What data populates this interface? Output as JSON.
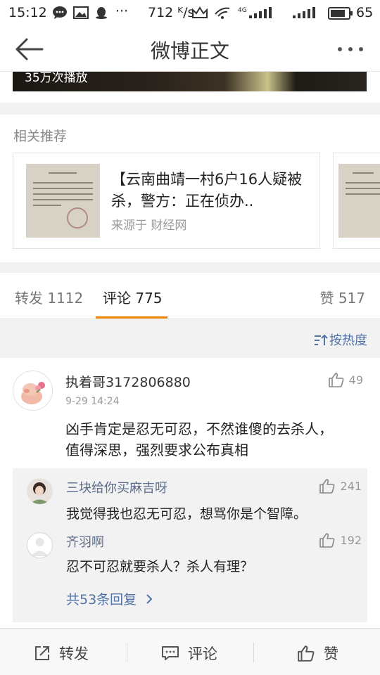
{
  "status_bar": {
    "time": "15:12",
    "network_speed": "712 ᴷ/s",
    "network_type": "4G",
    "battery": "65"
  },
  "nav": {
    "title": "微博正文"
  },
  "video": {
    "plays": "35万次播放"
  },
  "related": {
    "label": "相关推荐",
    "card": {
      "headline": "【云南曲靖一村6户16人疑被杀，警方：正在侦办..",
      "source": "来源于 财经网"
    }
  },
  "tabs": {
    "repost": "转发 1112",
    "comment": "评论 775",
    "like": "赞 517",
    "active": "comment"
  },
  "sort": {
    "label": "按热度"
  },
  "comment": {
    "user": "执着哥3172806880",
    "time": "9-29 14:24",
    "likes": "49",
    "text_line1": "凶手肯定是忍无可忍，不然谁傻的去杀人，",
    "text_line2": "值得深思，强烈要求公布真相"
  },
  "replies": [
    {
      "user": "三块给你买麻吉呀",
      "text": "我觉得我也忍无可忍，想骂你是个智障。",
      "likes": "241"
    },
    {
      "user": "齐羽啊",
      "text": "忍不可忍就要杀人？杀人有理？",
      "likes": "192"
    }
  ],
  "replies_more": "共53条回复",
  "bottom_bar": {
    "repost": "转发",
    "comment": "评论",
    "like": "赞"
  },
  "colors": {
    "accent": "#f08300",
    "link": "#5173a8",
    "reply_name": "#5d6c8a"
  }
}
